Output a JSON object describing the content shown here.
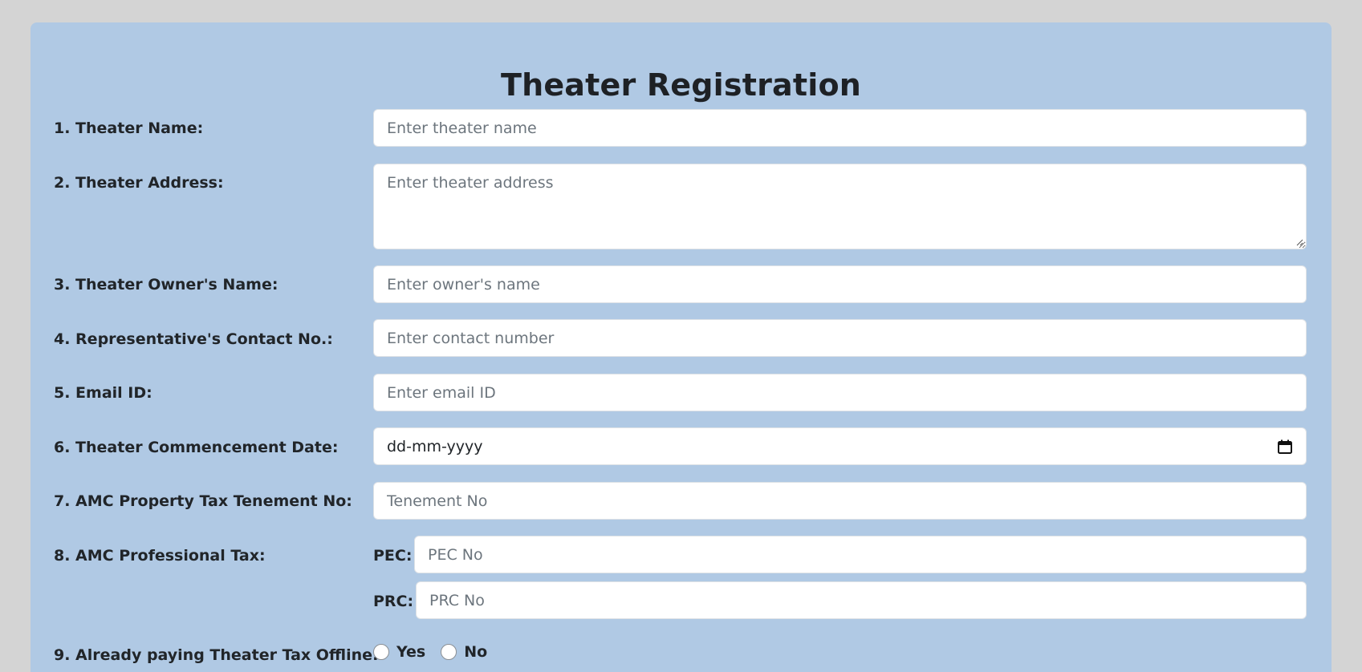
{
  "form": {
    "title": "Theater Registration",
    "fields": {
      "name": {
        "label": "1. Theater Name:",
        "placeholder": "Enter theater name"
      },
      "address": {
        "label": "2. Theater Address:",
        "placeholder": "Enter theater address"
      },
      "owner": {
        "label": "3. Theater Owner's Name:",
        "placeholder": "Enter owner's name"
      },
      "contact": {
        "label": "4. Representative's Contact No.:",
        "placeholder": "Enter contact number"
      },
      "email": {
        "label": "5. Email ID:",
        "placeholder": "Enter email ID"
      },
      "date": {
        "label": "6. Theater Commencement Date:",
        "value": "dd-mm-yyyy",
        "icon": "calendar-icon"
      },
      "tenement": {
        "label": "7. AMC Property Tax Tenement No:",
        "placeholder": "Tenement No"
      },
      "professional_tax": {
        "label": "8. AMC Professional Tax:",
        "pec_label": "PEC:",
        "pec_placeholder": "PEC No",
        "prc_label": "PRC:",
        "prc_placeholder": "PRC No"
      },
      "offline_tax": {
        "label": "9. Already paying Theater Tax Offline:",
        "options": [
          "Yes",
          "No"
        ]
      }
    }
  },
  "colors": {
    "page_bg": "#d4d4d4",
    "card_bg": "#b0c9e4",
    "input_bg": "#ffffff",
    "text": "#212529",
    "placeholder": "#6c757d"
  }
}
